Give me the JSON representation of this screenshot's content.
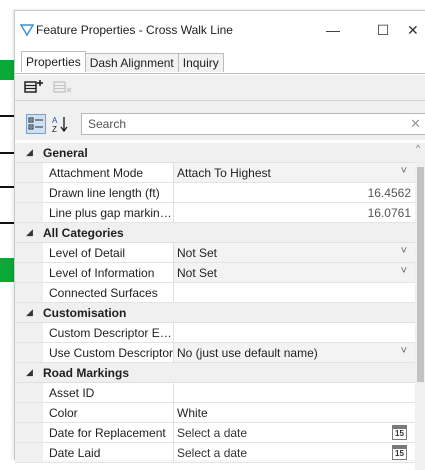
{
  "window": {
    "title": "Feature Properties - Cross Walk Line",
    "minimize_glyph": "—",
    "maximize_glyph": "☐",
    "close_glyph": "✕"
  },
  "tabs": [
    {
      "label": "Properties",
      "active": true
    },
    {
      "label": "Dash Alignment",
      "active": false
    },
    {
      "label": "Inquiry",
      "active": false
    }
  ],
  "toolbar": {
    "add_icon": "add-definition-icon",
    "remove_icon": "remove-definition-icon"
  },
  "search": {
    "placeholder": "Search",
    "clear_glyph": "✕",
    "categorized_icon": "categorized-view-icon",
    "alphabetical_icon": "sort-az-icon",
    "alphabetical_glyph": "A↓Z"
  },
  "categories": {
    "general": {
      "label": "General",
      "rows": [
        {
          "name": "Attachment Mode",
          "value": "Attach To Highest"
        },
        {
          "name": "Drawn line length (ft)",
          "value": "16.4562"
        },
        {
          "name": "Line plus gap marking...",
          "value": "16.0761"
        }
      ]
    },
    "all": {
      "label": "All Categories",
      "rows": [
        {
          "name": "Level of Detail",
          "value": "Not Set"
        },
        {
          "name": "Level of Information",
          "value": "Not Set"
        },
        {
          "name": "Connected Surfaces",
          "value": ""
        }
      ]
    },
    "custom": {
      "label": "Customisation",
      "rows": [
        {
          "name": "Custom Descriptor Exp...",
          "value": ""
        },
        {
          "name": "Use Custom Descriptor",
          "value": "No (just use default name)"
        }
      ]
    },
    "road": {
      "label": "Road Markings",
      "rows": [
        {
          "name": "Asset ID",
          "value": ""
        },
        {
          "name": "Color",
          "value": "White"
        },
        {
          "name": "Date for Replacement",
          "value": "Select a date"
        },
        {
          "name": "Date Laid",
          "value": "Select a date"
        }
      ]
    }
  },
  "calendar_day": "15",
  "colors": {
    "accent": "#4a90d9",
    "window_bg": "#ffffff",
    "panel_bg": "#f0f0f0",
    "app_green": "#0aa838"
  }
}
